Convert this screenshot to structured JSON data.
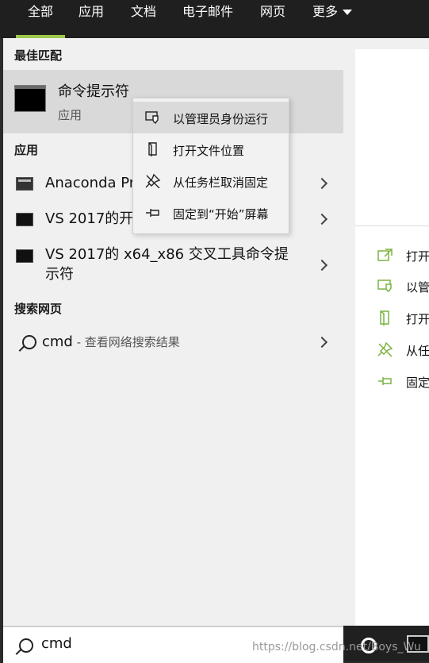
{
  "tabs": [
    {
      "label": "全部",
      "active": true
    },
    {
      "label": "应用"
    },
    {
      "label": "文档"
    },
    {
      "label": "电子邮件"
    },
    {
      "label": "网页"
    },
    {
      "label": "更多"
    }
  ],
  "sections": {
    "best_match": "最佳匹配",
    "apps": "应用",
    "web": "搜索网页"
  },
  "best_match": {
    "title": "命令提示符",
    "subtitle": "应用"
  },
  "apps": [
    {
      "label": "Anaconda Pr",
      "icon": "console-window-icon"
    },
    {
      "label": "VS 2017的开",
      "icon": "terminal-icon"
    },
    {
      "label_line1": "VS 2017的 x64_x86 交叉工具命令提",
      "label_line2": "示符",
      "icon": "terminal-icon"
    }
  ],
  "web_result": {
    "query": "cmd",
    "suffix": " - 查看网络搜索结果"
  },
  "context_menu": [
    {
      "label": "以管理员身份运行",
      "icon": "shield-run-icon",
      "highlighted": true
    },
    {
      "label": "打开文件位置",
      "icon": "file-location-icon"
    },
    {
      "label": "从任务栏取消固定",
      "icon": "unpin-icon"
    },
    {
      "label": "固定到“开始”屏幕",
      "icon": "pin-start-icon"
    }
  ],
  "right_actions": [
    {
      "label": "打开",
      "icon": "open-icon"
    },
    {
      "label": "以管",
      "icon": "shield-run-icon"
    },
    {
      "label": "打开",
      "icon": "file-location-icon"
    },
    {
      "label": "从任",
      "icon": "unpin-icon"
    },
    {
      "label": "固定",
      "icon": "pin-start-icon"
    }
  ],
  "search": {
    "value": "cmd"
  },
  "watermark": "https://blog.csdn.net/Boys_Wu",
  "colors": {
    "accent": "#9ec84a",
    "topbar": "#1f1f1f",
    "panel": "#f0f0f0",
    "highlight": "#d9d9d9"
  }
}
